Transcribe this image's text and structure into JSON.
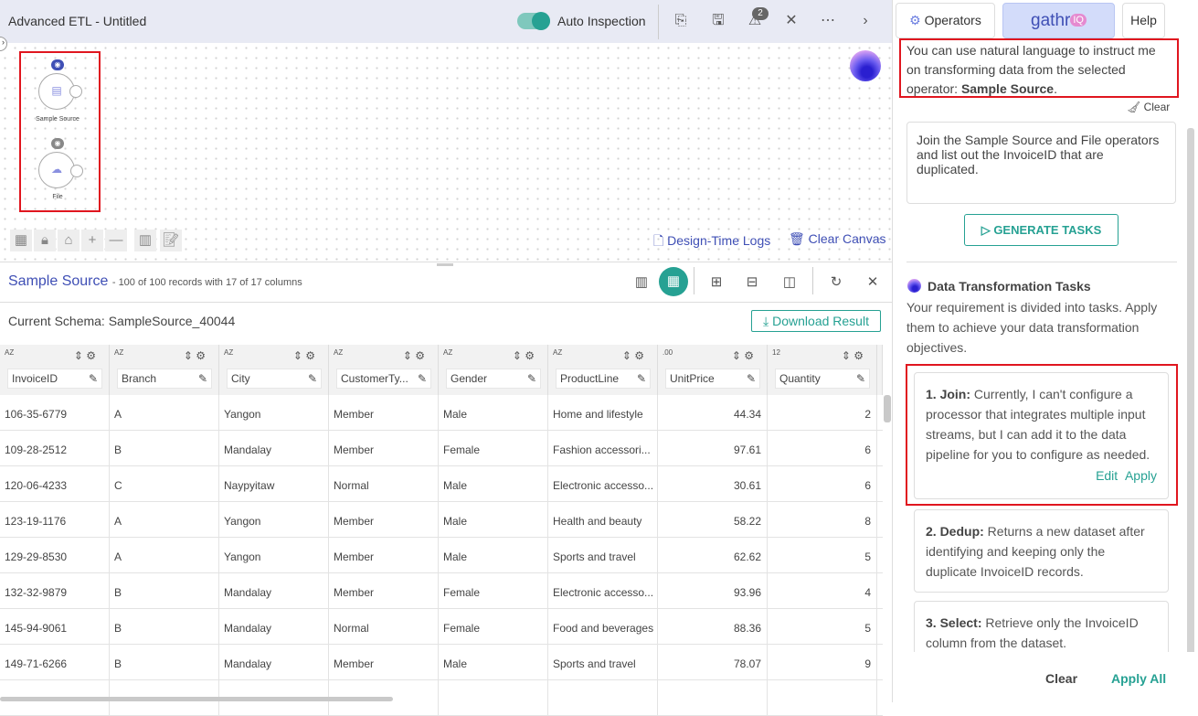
{
  "header": {
    "title": "Advanced ETL - Untitled",
    "auto_inspection_label": "Auto Inspection",
    "auto_inspection_on": true,
    "warning_count": "2"
  },
  "canvas": {
    "nodes": [
      {
        "label": "Sample Source",
        "eye_color": "#3f4fb5"
      },
      {
        "label": "File",
        "eye_color": "#888888"
      }
    ],
    "design_logs": "Design-Time Logs",
    "clear_canvas": "Clear Canvas"
  },
  "data_panel": {
    "title": "Sample Source",
    "subtitle": "- 100 of 100 records with 17 of 17 columns",
    "schema": "Current Schema: SampleSource_40044",
    "download": "Download Result",
    "columns": [
      {
        "name": "InvoiceID",
        "type": "AZ"
      },
      {
        "name": "Branch",
        "type": "AZ"
      },
      {
        "name": "City",
        "type": "AZ"
      },
      {
        "name": "CustomerTy...",
        "type": "AZ"
      },
      {
        "name": "Gender",
        "type": "AZ"
      },
      {
        "name": "ProductLine",
        "type": "AZ"
      },
      {
        "name": "UnitPrice",
        "type": ".00"
      },
      {
        "name": "Quantity",
        "type": "12"
      }
    ],
    "rows": [
      [
        "106-35-6779",
        "A",
        "Yangon",
        "Member",
        "Male",
        "Home and lifestyle",
        "44.34",
        "2"
      ],
      [
        "109-28-2512",
        "B",
        "Mandalay",
        "Member",
        "Female",
        "Fashion accessori...",
        "97.61",
        "6"
      ],
      [
        "120-06-4233",
        "C",
        "Naypyitaw",
        "Normal",
        "Male",
        "Electronic accesso...",
        "30.61",
        "6"
      ],
      [
        "123-19-1176",
        "A",
        "Yangon",
        "Member",
        "Male",
        "Health and beauty",
        "58.22",
        "8"
      ],
      [
        "129-29-8530",
        "A",
        "Yangon",
        "Member",
        "Male",
        "Sports and travel",
        "62.62",
        "5"
      ],
      [
        "132-32-9879",
        "B",
        "Mandalay",
        "Member",
        "Female",
        "Electronic accesso...",
        "93.96",
        "4"
      ],
      [
        "145-94-9061",
        "B",
        "Mandalay",
        "Normal",
        "Female",
        "Food and beverages",
        "88.36",
        "5"
      ],
      [
        "149-71-6266",
        "B",
        "Mandalay",
        "Member",
        "Male",
        "Sports and travel",
        "78.07",
        "9"
      ]
    ]
  },
  "right": {
    "tabs": {
      "operators": "Operators",
      "gathr": "gathr",
      "iq": "IQ",
      "help": "Help"
    },
    "intro": "You can use natural language to instruct me on transforming data from the selected operator: ",
    "intro_operator": "Sample Source",
    "clear": "Clear",
    "query": "Join the Sample Source and File operators and list out the InvoiceID that are duplicated.",
    "generate": "GENERATE TASKS",
    "tasks_title": "Data Transformation Tasks",
    "tasks_desc": "Your requirement is divided into tasks. Apply them to achieve your data transformation objectives.",
    "tasks": [
      {
        "title": "1. Join:",
        "text": " Currently, I can't configure a processor that integrates multiple input streams, but I can add it to the data pipeline for you to configure as needed.",
        "edit": "Edit",
        "apply": "Apply"
      },
      {
        "title": "2. Dedup:",
        "text": " Returns a new dataset after identifying and keeping only the duplicate InvoiceID records."
      },
      {
        "title": "3. Select:",
        "text": " Retrieve only the InvoiceID column from the dataset."
      }
    ],
    "clear_all": "Clear",
    "apply_all": "Apply All"
  },
  "colors": {
    "accent": "#26a193",
    "link": "#3f4fb5",
    "highlight": "#e0161f"
  }
}
